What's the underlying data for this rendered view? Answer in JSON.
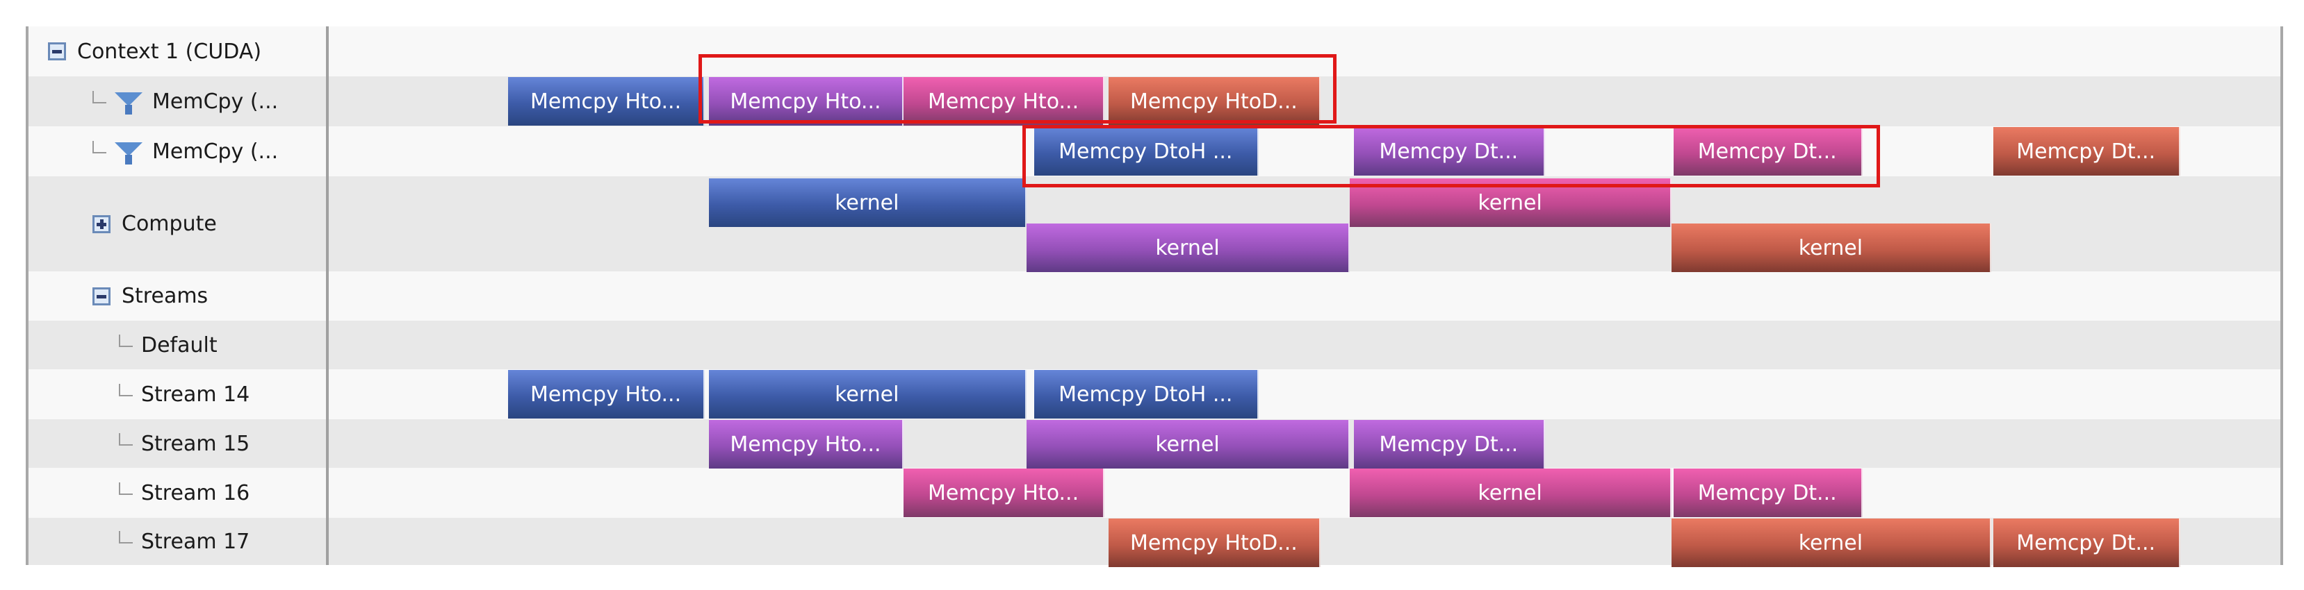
{
  "tree": {
    "rows": [
      {
        "label": "Context 1 (CUDA)",
        "icon": "collapse-minus-icon",
        "kind": "context"
      },
      {
        "label": "MemCpy (...",
        "icon": "filter-funnel-icon",
        "kind": "memcpy"
      },
      {
        "label": "MemCpy (...",
        "icon": "filter-funnel-icon",
        "kind": "memcpy"
      },
      {
        "label": "Compute",
        "icon": "expand-plus-icon",
        "kind": "compute"
      },
      {
        "label": "Streams",
        "icon": "collapse-minus-icon",
        "kind": "streams"
      },
      {
        "label": "Default",
        "icon": "tree-elbow-icon",
        "kind": "stream"
      },
      {
        "label": "Stream 14",
        "icon": "tree-elbow-icon",
        "kind": "stream"
      },
      {
        "label": "Stream 15",
        "icon": "tree-elbow-icon",
        "kind": "stream"
      },
      {
        "label": "Stream 16",
        "icon": "tree-elbow-icon",
        "kind": "stream"
      },
      {
        "label": "Stream 17",
        "icon": "tree-elbow-icon",
        "kind": "stream"
      }
    ]
  },
  "colors": {
    "blue": "#3d5ba8",
    "purple": "#9450b8",
    "pink": "#c04890",
    "orange": "#c05a48",
    "highlight": "#e01818"
  },
  "timeline": {
    "domain": [
      0,
      1000
    ],
    "bars": [
      {
        "row": 1,
        "lane": 0,
        "start": 92,
        "end": 193,
        "color": "blue",
        "label": "Memcpy Hto..."
      },
      {
        "row": 1,
        "lane": 0,
        "start": 195,
        "end": 295,
        "color": "purple",
        "label": "Memcpy Hto..."
      },
      {
        "row": 1,
        "lane": 0,
        "start": 295,
        "end": 398,
        "color": "pink",
        "label": "Memcpy Hto..."
      },
      {
        "row": 1,
        "lane": 0,
        "start": 400,
        "end": 509,
        "color": "orange",
        "label": "Memcpy HtoD..."
      },
      {
        "row": 2,
        "lane": 0,
        "start": 362,
        "end": 477,
        "color": "blue",
        "label": "Memcpy DtoH ..."
      },
      {
        "row": 2,
        "lane": 0,
        "start": 526,
        "end": 624,
        "color": "purple",
        "label": "Memcpy Dt..."
      },
      {
        "row": 2,
        "lane": 0,
        "start": 690,
        "end": 787,
        "color": "pink",
        "label": "Memcpy Dt..."
      },
      {
        "row": 2,
        "lane": 0,
        "start": 854,
        "end": 950,
        "color": "orange",
        "label": "Memcpy Dt..."
      },
      {
        "row": 3,
        "lane": 0,
        "start": 195,
        "end": 358,
        "color": "blue",
        "label": "kernel"
      },
      {
        "row": 3,
        "lane": 0,
        "start": 524,
        "end": 689,
        "color": "pink",
        "label": "kernel"
      },
      {
        "row": 3,
        "lane": 1,
        "start": 358,
        "end": 524,
        "color": "purple",
        "label": "kernel"
      },
      {
        "row": 3,
        "lane": 1,
        "start": 689,
        "end": 853,
        "color": "orange",
        "label": "kernel"
      },
      {
        "row": 6,
        "lane": 0,
        "start": 92,
        "end": 193,
        "color": "blue",
        "label": "Memcpy Hto..."
      },
      {
        "row": 6,
        "lane": 0,
        "start": 195,
        "end": 358,
        "color": "blue",
        "label": "kernel"
      },
      {
        "row": 6,
        "lane": 0,
        "start": 362,
        "end": 477,
        "color": "blue",
        "label": "Memcpy DtoH ..."
      },
      {
        "row": 7,
        "lane": 0,
        "start": 195,
        "end": 295,
        "color": "purple",
        "label": "Memcpy Hto..."
      },
      {
        "row": 7,
        "lane": 0,
        "start": 358,
        "end": 524,
        "color": "purple",
        "label": "kernel"
      },
      {
        "row": 7,
        "lane": 0,
        "start": 526,
        "end": 624,
        "color": "purple",
        "label": "Memcpy Dt..."
      },
      {
        "row": 8,
        "lane": 0,
        "start": 295,
        "end": 398,
        "color": "pink",
        "label": "Memcpy Hto..."
      },
      {
        "row": 8,
        "lane": 0,
        "start": 524,
        "end": 689,
        "color": "pink",
        "label": "kernel"
      },
      {
        "row": 8,
        "lane": 0,
        "start": 690,
        "end": 787,
        "color": "pink",
        "label": "Memcpy Dt..."
      },
      {
        "row": 9,
        "lane": 0,
        "start": 400,
        "end": 509,
        "color": "orange",
        "label": "Memcpy HtoD..."
      },
      {
        "row": 9,
        "lane": 0,
        "start": 689,
        "end": 853,
        "color": "orange",
        "label": "kernel"
      },
      {
        "row": 9,
        "lane": 0,
        "start": 854,
        "end": 950,
        "color": "orange",
        "label": "Memcpy Dt..."
      }
    ],
    "highlights": [
      {
        "name": "htod-overlap-highlight",
        "row": 1,
        "start": 192,
        "end": 515
      },
      {
        "name": "dtoh-overlap-highlight",
        "row": 2,
        "start": 358,
        "end": 794
      }
    ]
  }
}
